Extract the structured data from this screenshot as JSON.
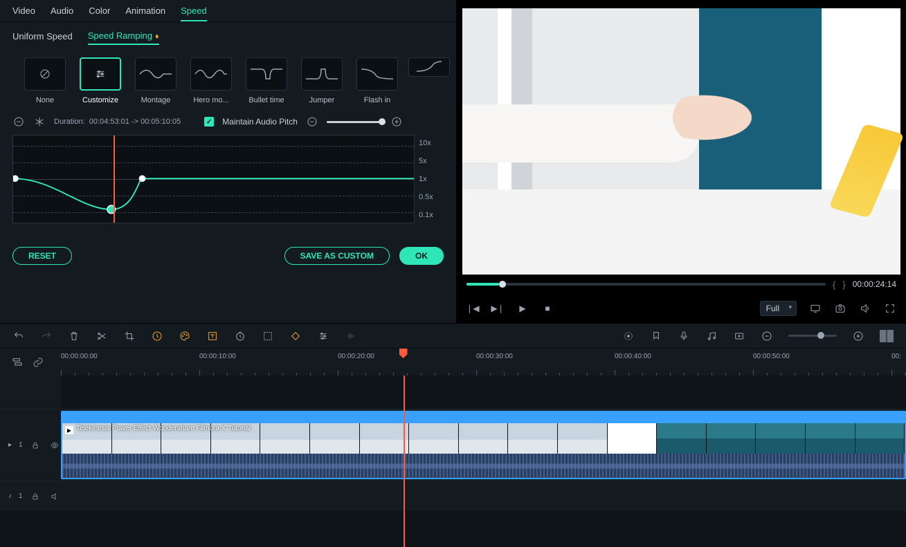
{
  "tabs": [
    "Video",
    "Audio",
    "Color",
    "Animation",
    "Speed"
  ],
  "activeTab": "Speed",
  "subtabs": {
    "uniform": "Uniform Speed",
    "ramping": "Speed Ramping"
  },
  "activeSubtab": "Speed Ramping",
  "presets": {
    "none": "None",
    "customize": "Customize",
    "montage": "Montage",
    "hero": "Hero mo...",
    "bullet": "Bullet time",
    "jumper": "Jumper",
    "flashin": "Flash in"
  },
  "activePreset": "Customize",
  "durationLabel": "Duration:",
  "durationValue": "00:04:53:01 -> 00:05:10:05",
  "maintainAudio": "Maintain Audio Pitch",
  "maintainAudioChecked": true,
  "graphLabels": [
    "10x",
    "5x",
    "1x",
    "0.5x",
    "0.1x"
  ],
  "buttons": {
    "reset": "RESET",
    "saveCustom": "SAVE AS CUSTOM",
    "ok": "OK"
  },
  "previewTimecode": "00:00:24:14",
  "playerQuality": "Full",
  "rulerTimes": [
    "00:00:00:00",
    "00:00:10:00",
    "00:00:20:00",
    "00:00:30:00",
    "00:00:40:00",
    "00:00:50:00",
    "00:"
  ],
  "clipTitle": "Telekinesis Power Effect   Wondershare Filmora X  Tutorial",
  "trackVideoLabel": "1",
  "trackAudioLabel": "1",
  "playheadPercent": 40.5,
  "graphPlayheadPercent": 25
}
